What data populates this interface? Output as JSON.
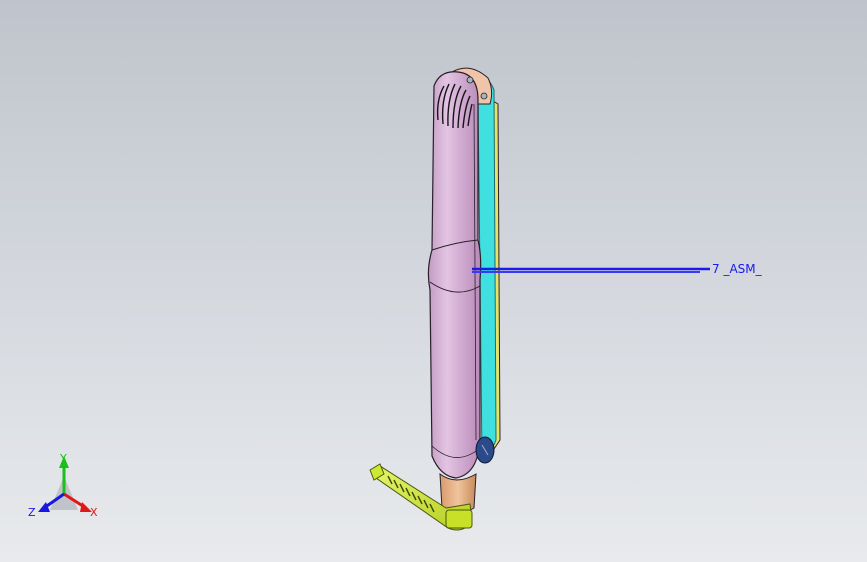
{
  "viewport": {
    "background_top": "#bfc4cc",
    "background_bottom": "#e8eaed"
  },
  "model": {
    "body_color": "#dcb8dc",
    "edge_color": "#2a1f2a",
    "rail_color": "#40e0e0",
    "side_color": "#e4e46a",
    "cord_color": "#d8f040",
    "sleeve_color": "#e8b890",
    "button_color": "#2a4a8a"
  },
  "annotation": {
    "text": "7 _ASM_",
    "color": "#1a1aee",
    "leader_color": "#1a1aee"
  },
  "triad": {
    "x_label": "X",
    "y_label": "Y",
    "z_label": "Z",
    "x_color": "#e01818",
    "y_color": "#18c018",
    "z_color": "#1818e0"
  }
}
